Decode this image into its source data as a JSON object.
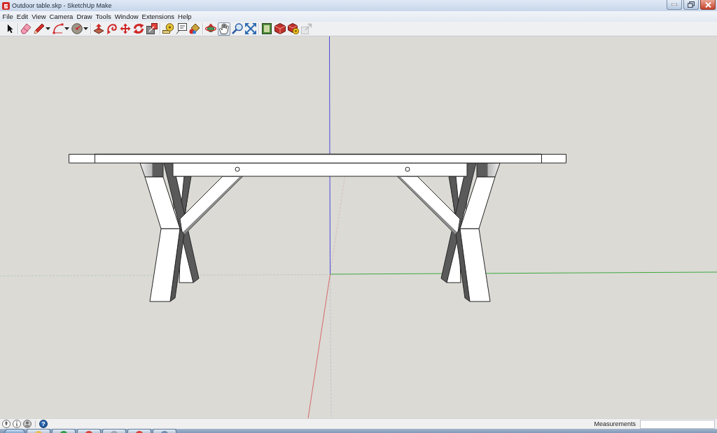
{
  "window": {
    "title": "Outdoor table.skp - SketchUp Make"
  },
  "menu": [
    {
      "label": "File"
    },
    {
      "label": "Edit"
    },
    {
      "label": "View"
    },
    {
      "label": "Camera"
    },
    {
      "label": "Draw"
    },
    {
      "label": "Tools"
    },
    {
      "label": "Window"
    },
    {
      "label": "Extensions"
    },
    {
      "label": "Help"
    }
  ],
  "toolbar": {
    "groups": [
      {
        "tools": [
          {
            "selected": false,
            "disabled": false,
            "has_menu": false
          }
        ]
      },
      {
        "tools": [
          {
            "selected": false,
            "disabled": false,
            "has_menu": false
          },
          {
            "selected": false,
            "disabled": false,
            "has_menu": true
          },
          {
            "selected": false,
            "disabled": false,
            "has_menu": true
          },
          {
            "selected": false,
            "disabled": false,
            "has_menu": true
          }
        ]
      },
      {
        "tools": [
          {
            "selected": false,
            "disabled": false,
            "has_menu": false
          },
          {
            "selected": false,
            "disabled": false,
            "has_menu": false
          },
          {
            "selected": false,
            "disabled": false,
            "has_menu": false
          },
          {
            "selected": false,
            "disabled": false,
            "has_menu": false
          },
          {
            "selected": false,
            "disabled": false,
            "has_menu": false
          }
        ]
      },
      {
        "tools": [
          {
            "selected": false,
            "disabled": false,
            "has_menu": false
          },
          {
            "selected": false,
            "disabled": false,
            "has_menu": false
          },
          {
            "selected": false,
            "disabled": false,
            "has_menu": false
          }
        ]
      },
      {
        "tools": [
          {
            "selected": false,
            "disabled": false,
            "has_menu": false
          },
          {
            "selected": true,
            "disabled": false,
            "has_menu": false
          },
          {
            "selected": false,
            "disabled": false,
            "has_menu": false
          },
          {
            "selected": false,
            "disabled": false,
            "has_menu": false
          }
        ]
      },
      {
        "tools": [
          {
            "selected": false,
            "disabled": false,
            "has_menu": false
          },
          {
            "selected": false,
            "disabled": false,
            "has_menu": false
          },
          {
            "selected": false,
            "disabled": false,
            "has_menu": false
          },
          {
            "selected": false,
            "disabled": true,
            "has_menu": false
          }
        ]
      }
    ]
  },
  "status_bar": {
    "help_button": "?",
    "measurements": {
      "label": "Measurements"
    }
  }
}
